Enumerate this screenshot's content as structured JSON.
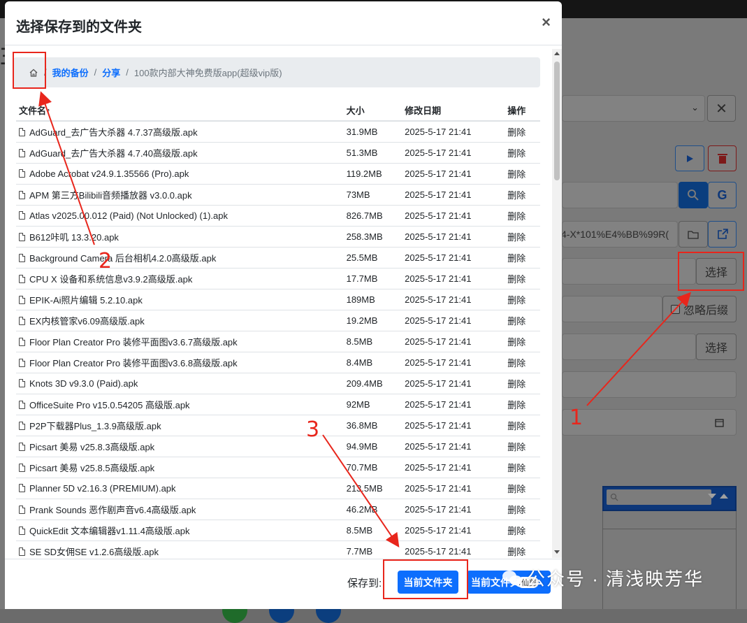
{
  "modal": {
    "title": "选择保存到的文件夹",
    "close_label": "×",
    "breadcrumb": {
      "home_icon": "home-icon",
      "separator": "/",
      "items": [
        "我的备份",
        "分享"
      ],
      "current": "100款内部大神免费版app(超级vip版)"
    },
    "table": {
      "headers": [
        "文件名↑",
        "大小",
        "修改日期",
        "操作"
      ],
      "rows": [
        {
          "name": "AdGuard_去广告大杀器 4.7.37高级版.apk",
          "size": "31.9MB",
          "date": "2025-5-17 21:41",
          "op": "删除"
        },
        {
          "name": "AdGuard_去广告大杀器 4.7.40高级版.apk",
          "size": "51.3MB",
          "date": "2025-5-17 21:41",
          "op": "删除"
        },
        {
          "name": "Adobe Acrobat v24.9.1.35566 (Pro).apk",
          "size": "119.2MB",
          "date": "2025-5-17 21:41",
          "op": "删除"
        },
        {
          "name": "APM 第三方Bilibili音频播放器 v3.0.0.apk",
          "size": "73MB",
          "date": "2025-5-17 21:41",
          "op": "删除"
        },
        {
          "name": "Atlas v2025.00.012 (Paid) (Not Unlocked) (1).apk",
          "size": "826.7MB",
          "date": "2025-5-17 21:41",
          "op": "删除"
        },
        {
          "name": "B612咔叽 13.3.20.apk",
          "size": "258.3MB",
          "date": "2025-5-17 21:41",
          "op": "删除"
        },
        {
          "name": "Background Camera 后台相机4.2.0高级版.apk",
          "size": "25.5MB",
          "date": "2025-5-17 21:41",
          "op": "删除"
        },
        {
          "name": "CPU X 设备和系统信息v3.9.2高级版.apk",
          "size": "17.7MB",
          "date": "2025-5-17 21:41",
          "op": "删除"
        },
        {
          "name": "EPIK-Ai照片编辑 5.2.10.apk",
          "size": "189MB",
          "date": "2025-5-17 21:41",
          "op": "删除"
        },
        {
          "name": "EX内核管家v6.09高级版.apk",
          "size": "19.2MB",
          "date": "2025-5-17 21:41",
          "op": "删除"
        },
        {
          "name": "Floor Plan Creator Pro 装修平面图v3.6.7高级版.apk",
          "size": "8.5MB",
          "date": "2025-5-17 21:41",
          "op": "删除"
        },
        {
          "name": "Floor Plan Creator Pro 装修平面图v3.6.8高级版.apk",
          "size": "8.4MB",
          "date": "2025-5-17 21:41",
          "op": "删除"
        },
        {
          "name": "Knots 3D v9.3.0 (Paid).apk",
          "size": "209.4MB",
          "date": "2025-5-17 21:41",
          "op": "删除"
        },
        {
          "name": "OfficeSuite Pro v15.0.54205 高级版.apk",
          "size": "92MB",
          "date": "2025-5-17 21:41",
          "op": "删除"
        },
        {
          "name": "P2P下载器Plus_1.3.9高级版.apk",
          "size": "36.8MB",
          "date": "2025-5-17 21:41",
          "op": "删除"
        },
        {
          "name": "Picsart 美易 v25.8.3高级版.apk",
          "size": "94.9MB",
          "date": "2025-5-17 21:41",
          "op": "删除"
        },
        {
          "name": "Picsart 美易 v25.8.5高级版.apk",
          "size": "70.7MB",
          "date": "2025-5-17 21:41",
          "op": "删除"
        },
        {
          "name": "Planner 5D v2.16.3 (PREMIUM).apk",
          "size": "213.5MB",
          "date": "2025-5-17 21:41",
          "op": "删除"
        },
        {
          "name": "Prank Sounds 恶作剧声音v6.4高级版.apk",
          "size": "46.2MB",
          "date": "2025-5-17 21:41",
          "op": "删除"
        },
        {
          "name": "QuickEdit 文本编辑器v1.11.4高级版.apk",
          "size": "8.5MB",
          "date": "2025-5-17 21:41",
          "op": "删除"
        },
        {
          "name": "SE SD女佣SE v1.2.6高级版.apk",
          "size": "7.7MB",
          "date": "2025-5-17 21:41",
          "op": "删除"
        }
      ]
    },
    "footer": {
      "save_to_label": "保存到:",
      "current_folder_btn": "当前文件夹",
      "current_folder_btn2": "当前文件夹",
      "btn2_suffix": "/仙剪"
    }
  },
  "background": {
    "select_btn_1": "选择",
    "ignore_suffix": "忽略后缀",
    "select_btn_2": "选择",
    "path_fragment": "4-X*101%E4%BB%99R("
  },
  "annotations": [
    "1",
    "2",
    "3"
  ],
  "watermark": "公众号 · 清浅映芳华",
  "colors": {
    "primary": "#0d6efd",
    "annotation": "#e8261c"
  }
}
